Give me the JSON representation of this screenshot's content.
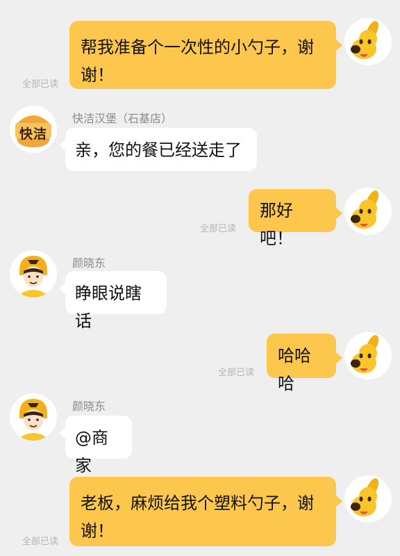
{
  "messages": [
    {
      "id": "m1",
      "direction": "out",
      "text_lines": [
        "帮我准备个一次性的小勺子，谢",
        "谢！"
      ],
      "status": "全部已读"
    },
    {
      "id": "m2",
      "direction": "in",
      "sender": "快洁汉堡（石基店）",
      "text": "亲，您的餐已经送走了",
      "avatar": "burger-logo"
    },
    {
      "id": "m3",
      "direction": "out",
      "text": "那好吧！",
      "status": "全部已读"
    },
    {
      "id": "m4",
      "direction": "in",
      "sender": "颜晓东",
      "text": "睁眼说瞎话",
      "avatar": "courier-avatar"
    },
    {
      "id": "m5",
      "direction": "out",
      "text": "哈哈哈",
      "status": "全部已读"
    },
    {
      "id": "m6",
      "direction": "in",
      "sender": "颜晓东",
      "text": "@商家",
      "avatar": "courier-avatar"
    },
    {
      "id": "m7",
      "direction": "out",
      "text_lines": [
        "老板，麻烦给我个塑料勺子，谢",
        "谢！"
      ],
      "status": "全部已读"
    }
  ],
  "logo_text": "快洁",
  "icons": {
    "self_avatar": "yellow-dog-icon",
    "courier_avatar": "courier-icon",
    "shop_avatar": "burger-logo-icon"
  },
  "colors": {
    "outgoing_bubble": "#fdc64c",
    "incoming_bubble": "#ffffff",
    "background": "#efefef"
  }
}
